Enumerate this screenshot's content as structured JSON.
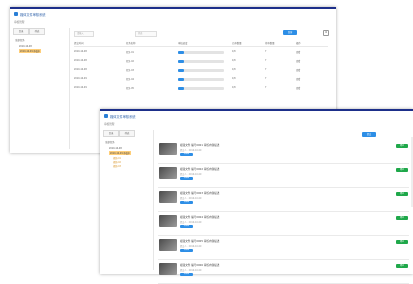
{
  "back_window": {
    "title": "媒体文件审核系统",
    "breadcrumb": "审核管理",
    "tabs": [
      "目录",
      "列表"
    ],
    "tree": {
      "root": "全部任务",
      "items": [
        "2019-10-08",
        "2019-10-09 审核中"
      ]
    },
    "toolbar": {
      "search_placeholder": "请输入",
      "filter_label": "状态",
      "search_button": "查询"
    },
    "columns": [
      "提交时间",
      "任务名称",
      "审核进度",
      "已审数量",
      "待审数量",
      "操作"
    ],
    "rows": [
      {
        "time": "2019-10-08",
        "name": "任务-01",
        "progress": 0.12,
        "done": "1/8",
        "pending": "7",
        "op": "查看"
      },
      {
        "time": "2019-10-08",
        "name": "任务-02",
        "progress": 0.12,
        "done": "1/8",
        "pending": "7",
        "op": "查看"
      },
      {
        "time": "2019-10-08",
        "name": "任务-03",
        "progress": 0.12,
        "done": "1/8",
        "pending": "7",
        "op": "查看"
      },
      {
        "time": "2019-10-09",
        "name": "任务-04",
        "progress": 0.12,
        "done": "1/8",
        "pending": "7",
        "op": "查看"
      },
      {
        "time": "2019-10-09",
        "name": "任务-05",
        "progress": 0.12,
        "done": "1/8",
        "pending": "7",
        "op": "查看"
      }
    ]
  },
  "front_window": {
    "title": "媒体文件审核系统",
    "breadcrumb": "审核管理",
    "tabs": [
      "目录",
      "列表"
    ],
    "tree": {
      "root": "全部任务",
      "items": [
        "2019-10-08",
        "2019-10-09 审核中",
        "视频-01",
        "视频-02",
        "视频-03"
      ]
    },
    "action_button": "提交",
    "items": [
      {
        "title": "视频文件 编号0001 审核内容描述",
        "sub": "提交人 · 2019-10-09",
        "badge": "待审核",
        "status": "通过"
      },
      {
        "title": "视频文件 编号0002 审核内容描述",
        "sub": "提交人 · 2019-10-09",
        "badge": "待审核",
        "status": "通过"
      },
      {
        "title": "视频文件 编号0003 审核内容描述",
        "sub": "提交人 · 2019-10-09",
        "badge": "待审核",
        "status": "通过"
      },
      {
        "title": "视频文件 编号0004 审核内容描述",
        "sub": "提交人 · 2019-10-09",
        "badge": "待审核",
        "status": "通过"
      },
      {
        "title": "视频文件 编号0005 审核内容描述",
        "sub": "提交人 · 2019-10-09",
        "badge": "待审核",
        "status": "通过"
      },
      {
        "title": "视频文件 编号0006 审核内容描述",
        "sub": "提交人 · 2019-10-09",
        "badge": "待审核",
        "status": "通过"
      }
    ]
  },
  "colors": {
    "title_bar": "#1d2f8a",
    "accent": "#2d8ee6",
    "status_ok": "#1fa84a",
    "tree_selected": "#ffcf7a"
  }
}
